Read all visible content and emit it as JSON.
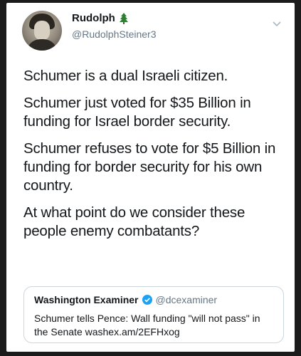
{
  "tweet": {
    "author_name": "Rudolph",
    "author_handle": "@RudolphSteiner3",
    "name_emoji_icon": "evergreen-tree-icon",
    "paragraphs": [
      "Schumer is a dual Israeli citizen.",
      "Schumer just voted for $35 Billion in funding for Israel border security.",
      "Schumer refuses to vote for $5 Billion in funding for border security for his own country.",
      "At what point do we consider these people enemy combatants?"
    ]
  },
  "quoted_tweet": {
    "author_name": "Washington Examiner",
    "verified": true,
    "author_handle": "@dcexaminer",
    "text": "Schumer tells Pence: Wall funding \"will not pass\" in the Senate washex.am/2EFHxog"
  },
  "colors": {
    "card_background": "#ffffff",
    "page_background": "#1b1b1b",
    "text_primary": "#14171a",
    "text_secondary": "#657786",
    "verified_blue": "#1da1f2",
    "tree_green": "#2e7d32"
  }
}
